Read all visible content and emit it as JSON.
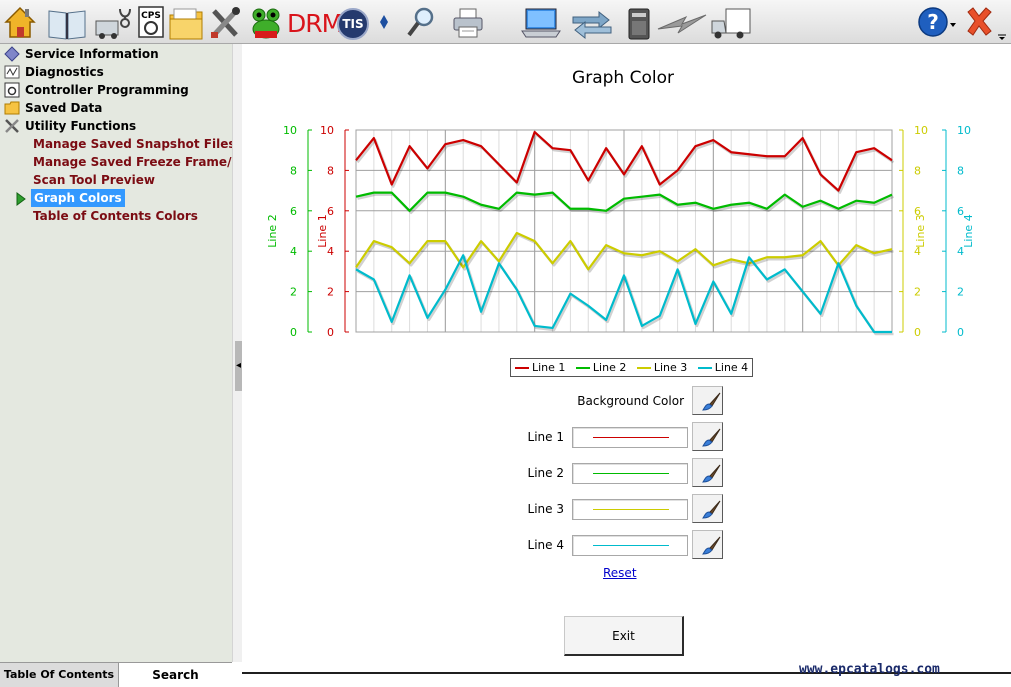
{
  "toolbar": {
    "icons": [
      "home-icon",
      "book-icon",
      "diagnostic-truck-icon",
      "cps-icon",
      "folder-icon",
      "tools-icon",
      "frog-icon",
      "drm-logo",
      "tis-logo",
      "splitter-arrow-icon",
      "magnifier-icon",
      "printer-icon",
      "laptop-icon",
      "sync-icon",
      "vci-device-icon",
      "lightning-icon",
      "truck-icon",
      "help-icon",
      "close-icon"
    ],
    "drm_label": "DRM",
    "tis_label": "TIS",
    "cps_label": "CPS"
  },
  "sidebar": {
    "items": [
      {
        "label": "Service Information",
        "icon": "diamond-icon"
      },
      {
        "label": "Diagnostics",
        "icon": "diagnostics-icon"
      },
      {
        "label": "Controller Programming",
        "icon": "controller-icon"
      },
      {
        "label": "Saved Data",
        "icon": "folder-icon"
      },
      {
        "label": "Utility Functions",
        "icon": "tools-icon"
      }
    ],
    "subitems": [
      {
        "label": "Manage Saved Snapshot Files"
      },
      {
        "label": "Manage Saved Freeze Frame/F"
      },
      {
        "label": "Scan Tool Preview"
      },
      {
        "label": "Graph Colors",
        "selected": true
      },
      {
        "label": "Table of Contents Colors"
      }
    ]
  },
  "tabs": {
    "toc": "Table Of Contents",
    "search": "Search"
  },
  "main": {
    "title": "Graph Color",
    "background_label": "Background Color",
    "rows": [
      {
        "label": "Line 1",
        "color": "#cc0000"
      },
      {
        "label": "Line 2",
        "color": "#00bb00"
      },
      {
        "label": "Line 3",
        "color": "#cccc00"
      },
      {
        "label": "Line 4",
        "color": "#00bbcc"
      }
    ],
    "reset_label": "Reset",
    "exit_label": "Exit"
  },
  "watermark": "www.epcatalogs.com",
  "chart_data": {
    "type": "line",
    "title": "",
    "x": [
      0,
      1,
      2,
      3,
      4,
      5,
      6,
      7,
      8,
      9,
      10,
      11,
      12,
      13,
      14,
      15,
      16,
      17,
      18,
      19,
      20,
      21,
      22,
      23,
      24,
      25,
      26,
      27,
      28,
      29,
      30
    ],
    "axes": [
      {
        "label": "Line 2",
        "color": "#00bb00",
        "ylim": [
          0,
          10
        ],
        "ticks": [
          "0",
          "2",
          "4",
          "6",
          "8",
          "10"
        ]
      },
      {
        "label": "Line 1",
        "color": "#cc0000",
        "ylim": [
          0,
          10
        ],
        "ticks": [
          "0",
          "2",
          "4",
          "6",
          "8",
          "10"
        ]
      },
      {
        "label": "Line 3",
        "color": "#cccc00",
        "ylim": [
          0,
          10
        ],
        "ticks": [
          "0",
          "2",
          "4",
          "6",
          "8",
          "10"
        ]
      },
      {
        "label": "Line 4",
        "color": "#00bbcc",
        "ylim": [
          0,
          10
        ],
        "ticks": [
          "0",
          "2",
          "4",
          "6",
          "8",
          "10"
        ]
      }
    ],
    "grid": true,
    "legend": "bottom",
    "series": [
      {
        "name": "Line 1",
        "color": "#cc0000",
        "values": [
          8.5,
          9.6,
          7.3,
          9.2,
          8.1,
          9.3,
          9.5,
          9.2,
          8.3,
          7.4,
          9.9,
          9.1,
          9.0,
          7.5,
          9.1,
          7.8,
          9.2,
          7.3,
          8.0,
          9.2,
          9.5,
          8.9,
          8.8,
          8.7,
          8.7,
          9.6,
          7.8,
          7.0,
          8.9,
          9.1,
          8.5
        ]
      },
      {
        "name": "Line 2",
        "color": "#00bb00",
        "values": [
          6.7,
          6.9,
          6.9,
          6.0,
          6.9,
          6.9,
          6.7,
          6.3,
          6.1,
          6.9,
          6.8,
          6.9,
          6.1,
          6.1,
          6.0,
          6.6,
          6.7,
          6.8,
          6.3,
          6.4,
          6.1,
          6.3,
          6.4,
          6.1,
          6.8,
          6.2,
          6.5,
          6.1,
          6.5,
          6.4,
          6.8
        ]
      },
      {
        "name": "Line 3",
        "color": "#cccc00",
        "values": [
          3.2,
          4.5,
          4.2,
          3.4,
          4.5,
          4.5,
          3.2,
          4.5,
          3.5,
          4.9,
          4.5,
          3.4,
          4.5,
          3.1,
          4.3,
          3.9,
          3.8,
          4.0,
          3.5,
          4.1,
          3.3,
          3.6,
          3.4,
          3.7,
          3.7,
          3.8,
          4.5,
          3.3,
          4.3,
          3.9,
          4.1
        ]
      },
      {
        "name": "Line 4",
        "color": "#00bbcc",
        "values": [
          3.1,
          2.6,
          0.5,
          2.8,
          0.7,
          2.1,
          3.8,
          1.0,
          3.4,
          2.1,
          0.3,
          0.2,
          1.9,
          1.3,
          0.6,
          2.8,
          0.3,
          0.8,
          3.1,
          0.4,
          2.5,
          0.9,
          3.7,
          2.6,
          3.1,
          2.0,
          0.9,
          3.4,
          1.3,
          0.0,
          0.0
        ]
      }
    ]
  }
}
